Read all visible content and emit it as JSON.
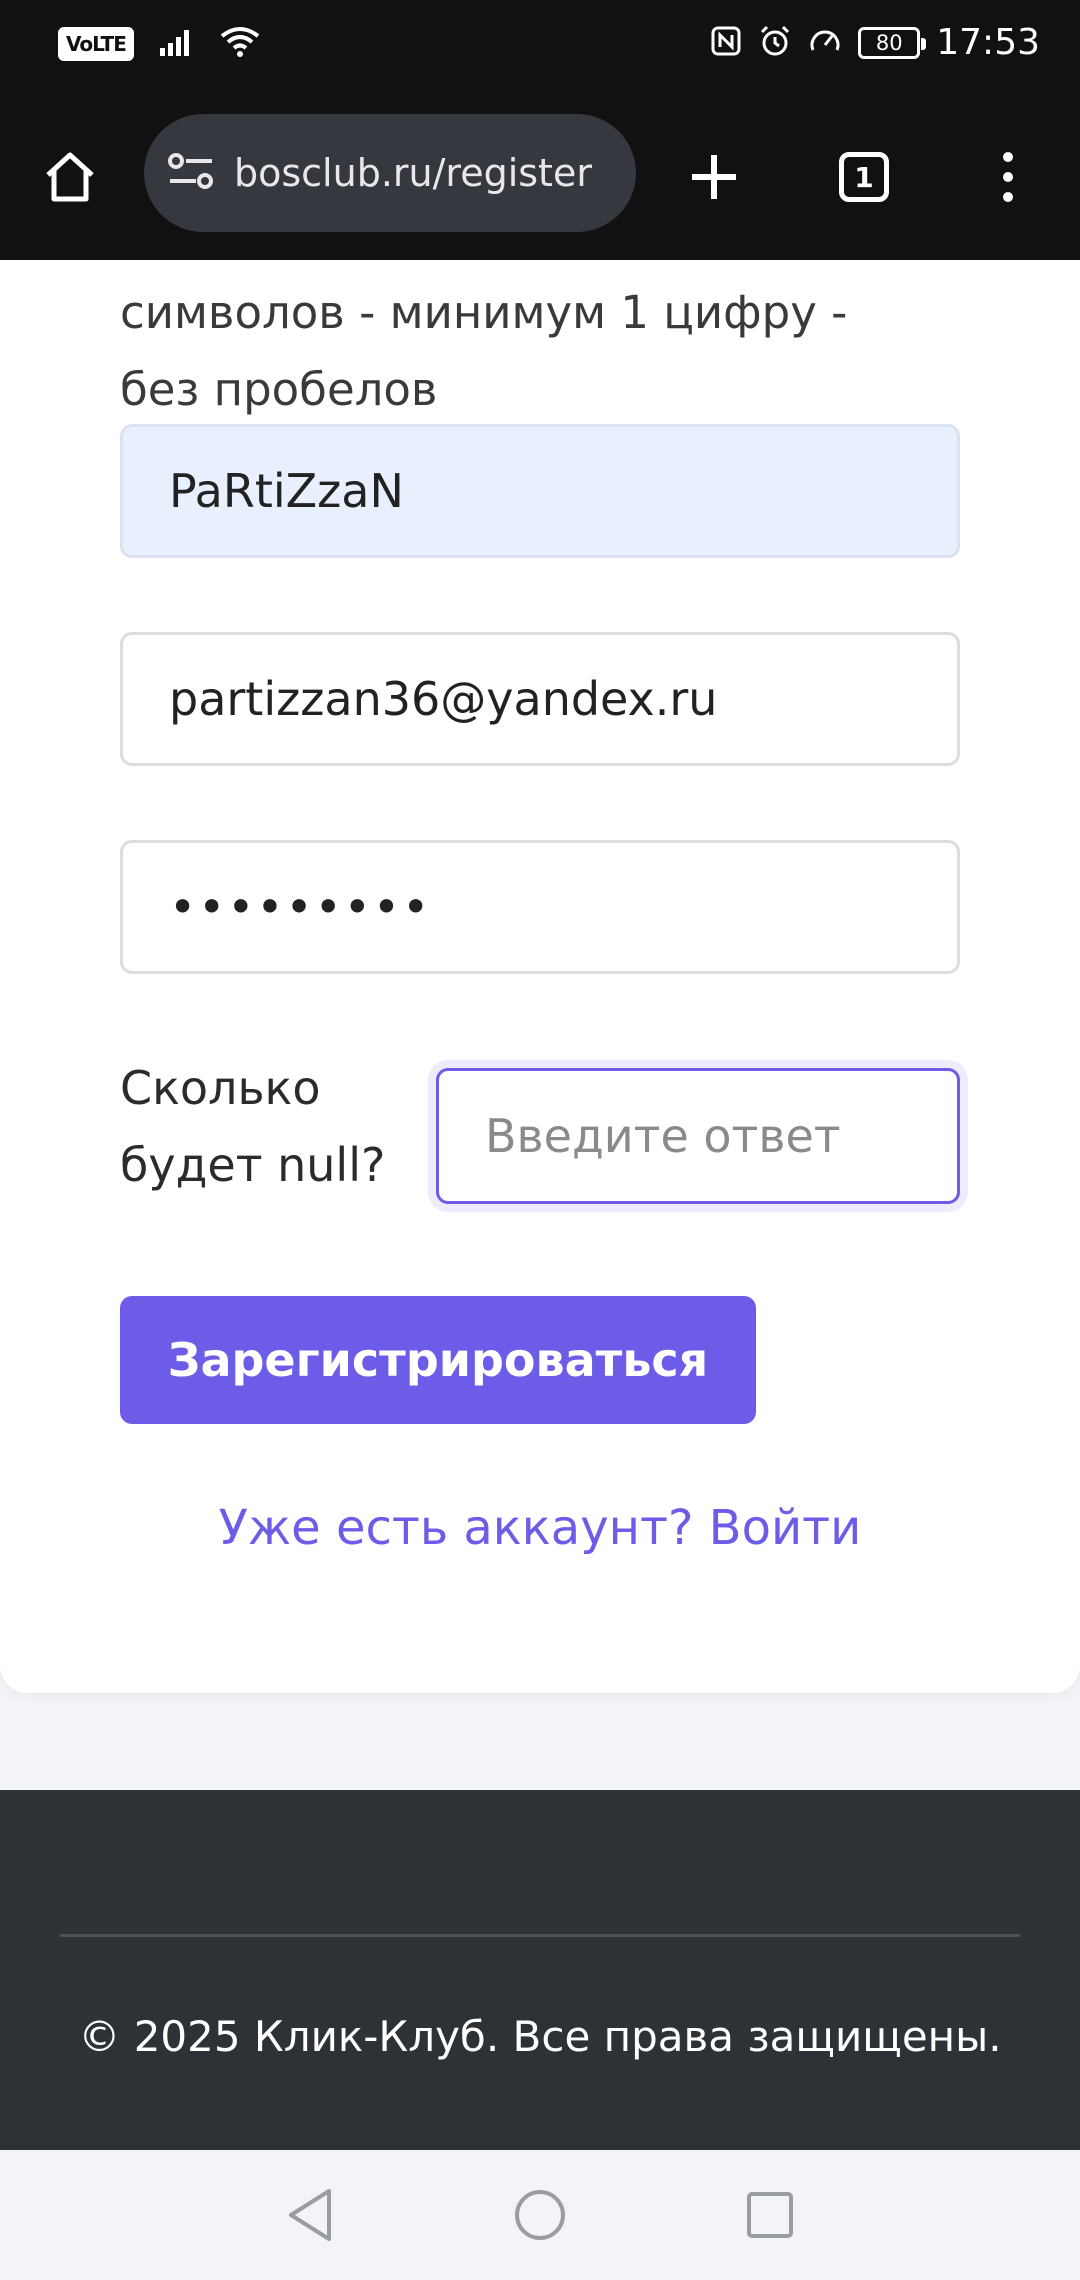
{
  "status_bar": {
    "volte": "VoLTE",
    "battery": "80",
    "time": "17:53"
  },
  "browser": {
    "url": "bosclub.ru/register",
    "tab_count": "1"
  },
  "form": {
    "password_hint": "символов - минимум 1 цифру - без пробелов",
    "username_value": "PaRtiZzaN",
    "email_value": "partizzan36@yandex.ru",
    "password_value": "•••••••••",
    "captcha_label": "Сколько будет null?",
    "captcha_placeholder": "Введите ответ",
    "register_button": "Зарегистрироваться",
    "login_link": "Уже есть аккаунт? Войти"
  },
  "footer": {
    "copyright": "© 2025 Клик-Клуб. Все права защищены."
  },
  "colors": {
    "accent": "#6c5ce7",
    "autofill": "#e8f0fe",
    "footer_bg": "#2c3235",
    "chrome_bg": "#111111"
  }
}
